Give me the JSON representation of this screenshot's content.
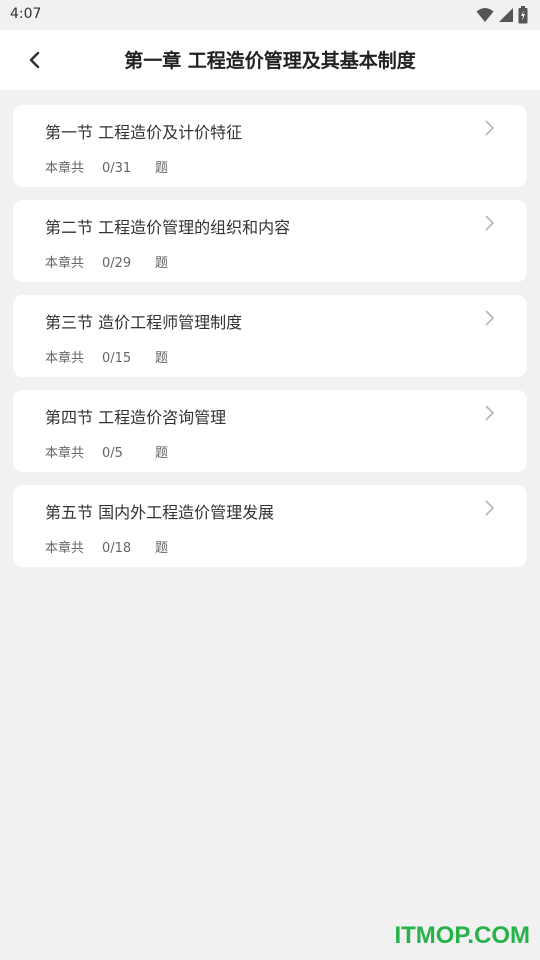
{
  "status_bar": {
    "time": "4:07",
    "icons": [
      "wifi-icon",
      "signal-icon",
      "battery-icon"
    ]
  },
  "header": {
    "back_icon": "chevron-left-icon",
    "title": "第一章 工程造价管理及其基本制度"
  },
  "sections": [
    {
      "title": "第一节 工程造价及计价特征",
      "prefix": "本章共",
      "progress": "0/31",
      "suffix": "题"
    },
    {
      "title": "第二节 工程造价管理的组织和内容",
      "prefix": "本章共",
      "progress": "0/29",
      "suffix": "题"
    },
    {
      "title": "第三节 造价工程师管理制度",
      "prefix": "本章共",
      "progress": "0/15",
      "suffix": "题"
    },
    {
      "title": "第四节 工程造价咨询管理",
      "prefix": "本章共",
      "progress": "0/5",
      "suffix": "题"
    },
    {
      "title": "第五节 国内外工程造价管理发展",
      "prefix": "本章共",
      "progress": "0/18",
      "suffix": "题"
    }
  ],
  "watermark": "ITMOP.COM",
  "colors": {
    "background": "#f1f1f1",
    "card": "#ffffff",
    "watermark": "#26b34a"
  }
}
